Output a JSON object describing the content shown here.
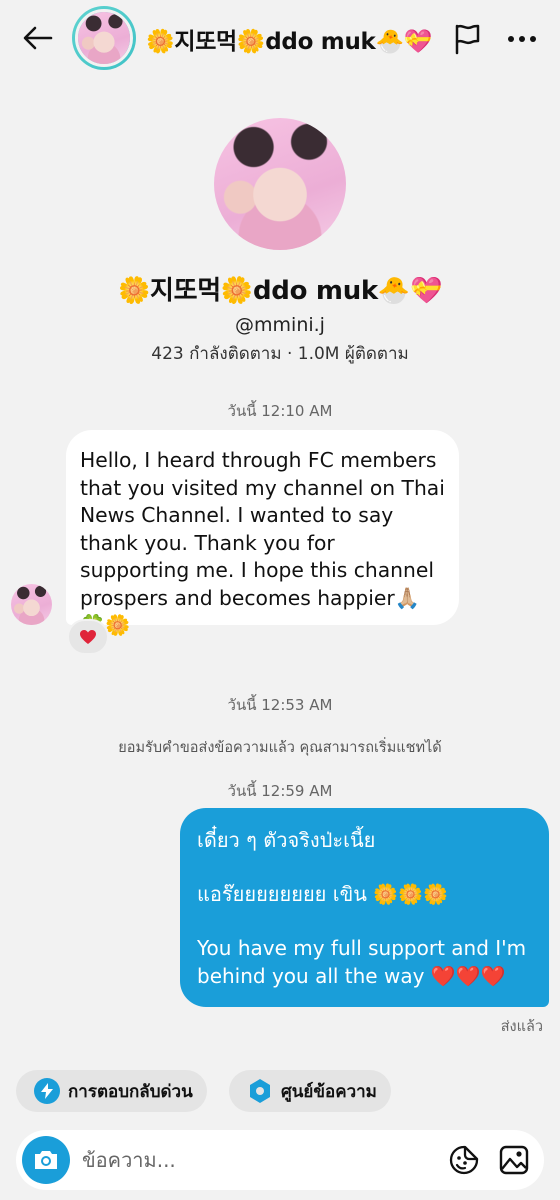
{
  "header": {
    "title": "🌼지또먹🌼ddo muk🐣💝"
  },
  "profile": {
    "name": "🌼지또먹🌼ddo muk🐣💝",
    "handle": "@mmini.j",
    "stats": "423 กำลังติดตาม · 1.0M ผู้ติดตาม"
  },
  "thread": {
    "timestamp_1": "วันนี้ 12:10 AM",
    "incoming_message": "Hello, I heard through FC members that you visited my channel on Thai News Channel. I wanted to say thank you. Thank you for supporting me. I hope this channel prospers and becomes happier🙏🏼🍀🌼",
    "reaction": "❤️",
    "timestamp_2": "วันนี้ 12:53 AM",
    "system_message": "ยอมรับคำขอส่งข้อความแล้ว คุณสามารถเริ่มแชทได้",
    "timestamp_3": "วันนี้ 12:59 AM",
    "outgoing_line_1": "เดี๋ยว ๆ ตัวจริงป่ะเนี้ย",
    "outgoing_line_2": "แอร๊ยยยยยยยย เขิน 🌼🌼🌼",
    "outgoing_line_3": "You have my full support and I'm",
    "outgoing_line_4": "behind you all the way ❤️❤️❤️",
    "sent_status": "ส่งแล้ว"
  },
  "quick_actions": {
    "quick_reply_label": "การตอบกลับด่วน",
    "message_center_label": "ศูนย์ข้อความ"
  },
  "composer": {
    "placeholder": "ข้อความ..."
  },
  "colors": {
    "accent": "#1a9ed9",
    "background": "#f2f2f2",
    "incoming_bubble": "#ffffff",
    "reaction_heart": "#e0243a"
  }
}
